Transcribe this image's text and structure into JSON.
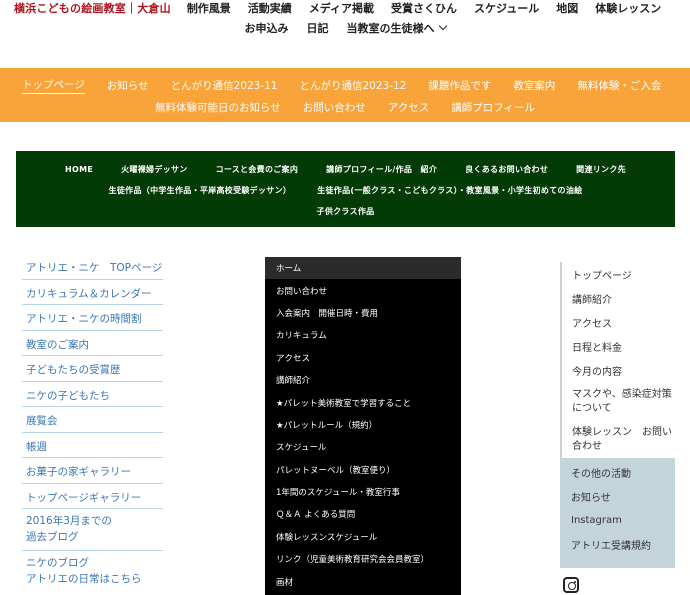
{
  "topnav": {
    "site_title": "横浜こどもの絵画教室｜大倉山",
    "row1": [
      "制作風景",
      "活動実績",
      "メディア掲載",
      "受賞さくひん",
      "スケジュール",
      "地図",
      "体験レッスン"
    ],
    "row2": [
      "お申込み",
      "日記",
      "当教室の生徒様へ"
    ]
  },
  "orange_nav": {
    "row1": [
      "トップページ",
      "お知らせ",
      "とんがり通信2023-11",
      "とんがり通信2023-12",
      "課題作品です",
      "教室案内",
      "無料体験・ご入会"
    ],
    "row2": [
      "無料体験可能日のお知らせ",
      "お問い合わせ",
      "アクセス",
      "講師プロフィール"
    ],
    "active": "トップページ"
  },
  "green_nav": {
    "row1": [
      "HOME",
      "火曜裸婦デッサン",
      "コースと会費のご案内",
      "講師プロフィール/作品　紹介",
      "良くあるお問い合わせ",
      "関連リンク先"
    ],
    "row2": [
      "生徒作品（中学生作品・平岸高校受験デッサン）",
      "生徒作品(一般クラス・こどもクラス）・教室風景・小学生初めての油絵"
    ],
    "row3": [
      "子供クラス作品"
    ]
  },
  "left_nav": {
    "items": [
      "アトリエ・ニケ　TOPページ",
      "カリキュラム＆カレンダー",
      "アトリエ・ニケの時間割",
      "教室のご案内",
      "子どもたちの受賞歴",
      "ニケの子どもたち",
      "展覧会",
      "帳週",
      "お菓子の家ギャラリー",
      "トップページギャラリー"
    ],
    "two_line": [
      [
        "2016年3月までの",
        "過去ブログ"
      ],
      [
        "ニケのブログ",
        "アトリエの日常はこちら"
      ]
    ]
  },
  "center_menu": {
    "items": [
      "ホーム",
      "お問い合わせ",
      "入会案内　開催日時・費用",
      "カリキュラム",
      "アクセス",
      "講師紹介",
      "★パレット美術教室で学習すること",
      "★パレットルール（規約）",
      "スケジュール",
      "パレットヌーベル（教室便り）",
      "1年間のスケジュール・教室行事",
      "Ｑ＆Ａ よくある質問",
      "体験レッスンスケジュール",
      "リンク（児童美術教育研究会会員教室）",
      "画材"
    ],
    "active": "ホーム"
  },
  "right_nav": {
    "items": [
      "トップページ",
      "講師紹介",
      "アクセス",
      "日程と料金",
      "今月の内容"
    ],
    "two_line": [
      "マスクや、感染症対策について",
      "体験レッスン　お問い合わせ"
    ],
    "gray_items": [
      "その他の活動",
      "お知らせ",
      "Instagram",
      "アトリエ受講規約"
    ]
  },
  "icons": {
    "social": "instagram-icon",
    "dropdown": "chevron-down-icon"
  },
  "colors": {
    "brand_red": "#b0141e",
    "orange_bar": "#f9a33b",
    "green_bar": "#033b07",
    "link_blue": "#3a77b6",
    "gray_panel": "#c4d4db"
  }
}
